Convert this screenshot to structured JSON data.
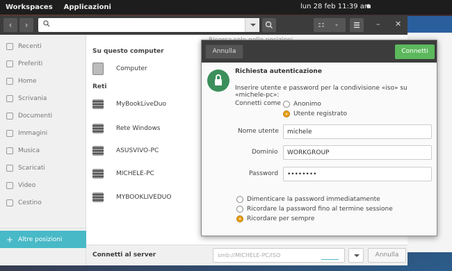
{
  "topbar": {
    "workspaces": "Workspaces",
    "apps": "Applicazioni",
    "clock": "lun 28 feb  11:39 am"
  },
  "sidebar": {
    "items": [
      {
        "label": "Recenti",
        "icon": "clock-icon"
      },
      {
        "label": "Preferiti",
        "icon": "star-icon"
      },
      {
        "label": "Home",
        "icon": "home-icon"
      },
      {
        "label": "Scrivania",
        "icon": "desktop-icon"
      },
      {
        "label": "Documenti",
        "icon": "document-icon"
      },
      {
        "label": "Immagini",
        "icon": "image-icon"
      },
      {
        "label": "Musica",
        "icon": "music-icon"
      },
      {
        "label": "Scaricati",
        "icon": "download-icon"
      },
      {
        "label": "Video",
        "icon": "video-icon"
      },
      {
        "label": "Cestino",
        "icon": "trash-icon"
      }
    ],
    "other": "Altre posizioni"
  },
  "content": {
    "hint": "Ricerca solo nelle posizioni",
    "section_computer": "Su questo computer",
    "computer": "Computer",
    "section_networks": "Reti",
    "networks": [
      "MyBookLiveDuo",
      "Rete Windows",
      "ASUSVIVO-PC",
      "MICHELE-PC",
      "MYBOOKLIVEDUO"
    ]
  },
  "bottom": {
    "label": "Connetti al server",
    "placeholder": "smb://MICHELE-PC/ISO",
    "button": "Annulla"
  },
  "dialog": {
    "cancel": "Annulla",
    "connect": "Connetti",
    "title": "Richiesta autenticazione",
    "message": "Inserire utente e password per la condivisione «iso» su «michele-pc»:",
    "connect_as": "Connetti come",
    "anon": "Anonimo",
    "registered": "Utente registrato",
    "user_label": "Nome utente",
    "user_value": "michele",
    "domain_label": "Dominio",
    "domain_value": "WORKGROUP",
    "password_label": "Password",
    "password_value": "••••••••",
    "opt1": "Dimenticare la password immediatamente",
    "opt2": "Ricordare la password fino al termine sessione",
    "opt3": "Ricordare per sempre"
  }
}
